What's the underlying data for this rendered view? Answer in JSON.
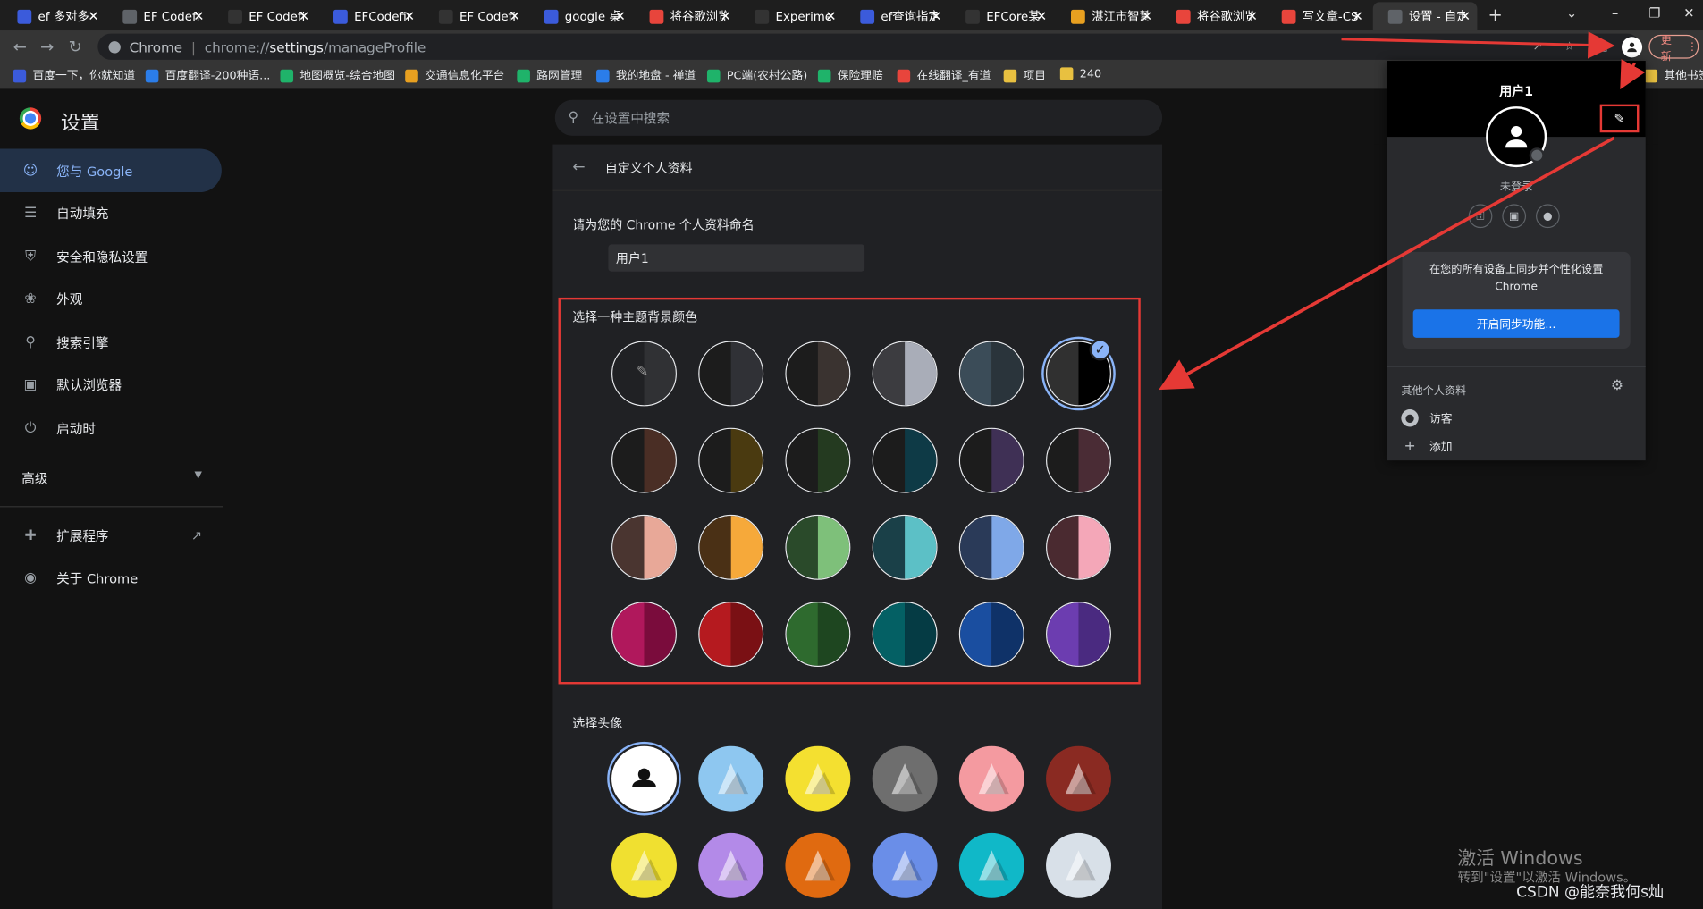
{
  "tabs": [
    {
      "title": "ef 多对多",
      "color": "#3b5bdb"
    },
    {
      "title": "EF Codefi",
      "color": "#5f6368"
    },
    {
      "title": "EF Codefi",
      "color": "#333"
    },
    {
      "title": "EFCodefir",
      "color": "#3b5bdb"
    },
    {
      "title": "EF Codefi",
      "color": "#333"
    },
    {
      "title": "google 桌面",
      "color": "#3b5bdb"
    },
    {
      "title": "将谷歌浏览",
      "color": "#e8453c"
    },
    {
      "title": "Experime",
      "color": "#333"
    },
    {
      "title": "ef查询指定",
      "color": "#3b5bdb"
    },
    {
      "title": "EFCore某",
      "color": "#333"
    },
    {
      "title": "湛江市智慧",
      "color": "#e8a020"
    },
    {
      "title": "将谷歌浏览",
      "color": "#e8453c"
    },
    {
      "title": "写文章-CS",
      "color": "#e8453c"
    },
    {
      "title": "设置 - 自定",
      "color": "#5f6368"
    }
  ],
  "toolbar": {
    "chrome_label": "Chrome",
    "url_prefix": "chrome://",
    "url_host": "settings",
    "url_path": "/manageProfile",
    "update_label": "更新"
  },
  "bookmarks": [
    {
      "label": "百度一下，你就知道",
      "color": "#3b5bdb"
    },
    {
      "label": "百度翻译-200种语...",
      "color": "#2b7de9"
    },
    {
      "label": "地图概览-综合地图",
      "color": "#1fb36a"
    },
    {
      "label": "交通信息化平台",
      "color": "#e8a020"
    },
    {
      "label": "路网管理",
      "color": "#1fb36a"
    },
    {
      "label": "我的地盘 - 禅道",
      "color": "#2b7de9"
    },
    {
      "label": "PC端(农村公路)",
      "color": "#1fb36a"
    },
    {
      "label": "保险理赔",
      "color": "#1fb36a"
    },
    {
      "label": "在线翻译_有道",
      "color": "#e8453c"
    },
    {
      "label": "项目",
      "color": "#e8c040"
    },
    {
      "label": "240",
      "color": "#e8c040"
    },
    {
      "label": "其他书签",
      "color": "#e8c040"
    }
  ],
  "header": {
    "title": "设置",
    "search_placeholder": "在设置中搜索"
  },
  "sidebar": {
    "items": [
      {
        "label": "您与 Google",
        "icon": "person-icon"
      },
      {
        "label": "自动填充",
        "icon": "clipboard-icon"
      },
      {
        "label": "安全和隐私设置",
        "icon": "shield-icon"
      },
      {
        "label": "外观",
        "icon": "palette-icon"
      },
      {
        "label": "搜索引擎",
        "icon": "search-icon"
      },
      {
        "label": "默认浏览器",
        "icon": "browser-icon"
      },
      {
        "label": "启动时",
        "icon": "power-icon"
      }
    ],
    "advanced": "高级",
    "extensions": "扩展程序",
    "about": "关于 Chrome"
  },
  "main": {
    "page_title": "自定义个人资料",
    "name_label": "请为您的 Chrome 个人资料命名",
    "name_value": "用户1",
    "theme_label": "选择一种主题背景颜色",
    "avatar_label": "选择头像",
    "themes": [
      [
        "#202124",
        "#303134"
      ],
      [
        "#1c1c1c",
        "#303136"
      ],
      [
        "#1c1c1c",
        "#3a3330"
      ],
      [
        "#3c3c40",
        "#a9adb8"
      ],
      [
        "#3b4c58",
        "#2a343b"
      ],
      [
        "#303030",
        "#000000"
      ],
      [
        "#1c1c1c",
        "#4a2e25"
      ],
      [
        "#1c1c1c",
        "#4a3a10"
      ],
      [
        "#1c1c1c",
        "#243a20"
      ],
      [
        "#1c1c1c",
        "#0e3a46"
      ],
      [
        "#1c1c1c",
        "#3f3055"
      ],
      [
        "#1c1c1c",
        "#4a2c35"
      ],
      [
        "#4a3530",
        "#e8a898"
      ],
      [
        "#4a3015",
        "#f6a93a"
      ],
      [
        "#2a4a2a",
        "#7ec07a"
      ],
      [
        "#1a4048",
        "#5cc0c6"
      ],
      [
        "#2a3a58",
        "#7fa8e8"
      ],
      [
        "#4a2a30",
        "#f4a7b8"
      ],
      [
        "#b0185c",
        "#7a0c3c"
      ],
      [
        "#b51a1f",
        "#7a1014"
      ],
      [
        "#2e6a2e",
        "#1e4620"
      ],
      [
        "#046064",
        "#053b44"
      ],
      [
        "#1a4ea0",
        "#0f3268"
      ],
      [
        "#6c3db0",
        "#4a2a80"
      ]
    ],
    "avatars": [
      {
        "name": "default-avatar",
        "bg": "#ffffff"
      },
      {
        "name": "cat-avatar",
        "bg": "#8ec7f0"
      },
      {
        "name": "fox-avatar",
        "bg": "#f4e030"
      },
      {
        "name": "dragon-avatar",
        "bg": "#6e6e6e"
      },
      {
        "name": "elephant-avatar",
        "bg": "#f49aa0"
      },
      {
        "name": "fox2-avatar",
        "bg": "#8a2a22"
      },
      {
        "name": "mouse-avatar",
        "bg": "#f0e030"
      },
      {
        "name": "panda-avatar",
        "bg": "#b38ae8"
      },
      {
        "name": "penguin-avatar",
        "bg": "#e06a10"
      },
      {
        "name": "bird-avatar",
        "bg": "#6a8ee8"
      },
      {
        "name": "rabbit-avatar",
        "bg": "#10b8c8"
      },
      {
        "name": "unicorn-avatar",
        "bg": "#d8e0e8"
      }
    ]
  },
  "popup": {
    "user": "用户1",
    "status": "未登录",
    "sync_text": "在您的所有设备上同步并个性化设置 Chrome",
    "sync_button": "开启同步功能...",
    "other_profiles": "其他个人资料",
    "guest": "访客",
    "add": "添加"
  },
  "overlay": {
    "watermark_title": "激活 Windows",
    "watermark_sub": "转到\"设置\"以激活 Windows。",
    "csdn": "CSDN @能奈我何s灿"
  },
  "colors": {
    "accent": "#8ab4f8",
    "highlight": "#e53935",
    "sync_button": "#1a73e8"
  }
}
